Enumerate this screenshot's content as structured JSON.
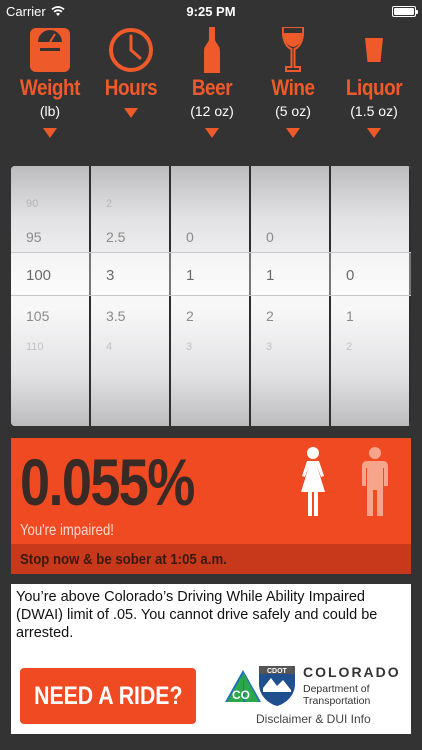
{
  "status_bar": {
    "carrier": "Carrier",
    "time": "9:25 PM"
  },
  "drinks": [
    {
      "title": "Weight",
      "unit": "(lb)",
      "icon": "scale-icon"
    },
    {
      "title": "Hours",
      "unit": "",
      "icon": "clock-icon"
    },
    {
      "title": "Beer",
      "unit": "(12 oz)",
      "icon": "beer-bottle-icon"
    },
    {
      "title": "Wine",
      "unit": "(5 oz)",
      "icon": "wine-glass-icon"
    },
    {
      "title": "Liquor",
      "unit": "(1.5 oz)",
      "icon": "shot-glass-icon"
    }
  ],
  "picker": {
    "weight": {
      "top_faint": "90",
      "above": "95",
      "selected": "100",
      "below": "105",
      "bottom_faint": "110"
    },
    "hours": {
      "top_faint": "2",
      "above": "2.5",
      "selected": "3",
      "below": "3.5",
      "bottom_faint": "4"
    },
    "beer": {
      "top_faint": "",
      "above": "0",
      "selected": "1",
      "below": "2",
      "bottom_faint": "3"
    },
    "wine": {
      "top_faint": "",
      "above": "0",
      "selected": "1",
      "below": "2",
      "bottom_faint": "3"
    },
    "liquor": {
      "top_faint": "",
      "above": "",
      "selected": "0",
      "below": "1",
      "bottom_faint": "2"
    }
  },
  "result": {
    "bac": "0.055%",
    "status": "You're impaired!",
    "sober_message": "Stop now & be sober at 1:05 a.m.",
    "female_selected": true
  },
  "info": {
    "text": "You’re above Colorado’s Driving While Ability Impaired (DWAI) limit of .05. You cannot drive safely and could be arrested.",
    "ride_button": "NEED A RIDE?",
    "cdot_badge": "CDOT",
    "cdot_co": "CO",
    "cdot_name": "COLORADO",
    "cdot_sub_1": "Department of",
    "cdot_sub_2": "Transportation",
    "disclaimer": "Disclaimer & DUI Info"
  },
  "colors": {
    "accent": "#ef5a2a",
    "background": "#333333",
    "panel": "#f04a23",
    "panel_dark": "#c8381a"
  }
}
